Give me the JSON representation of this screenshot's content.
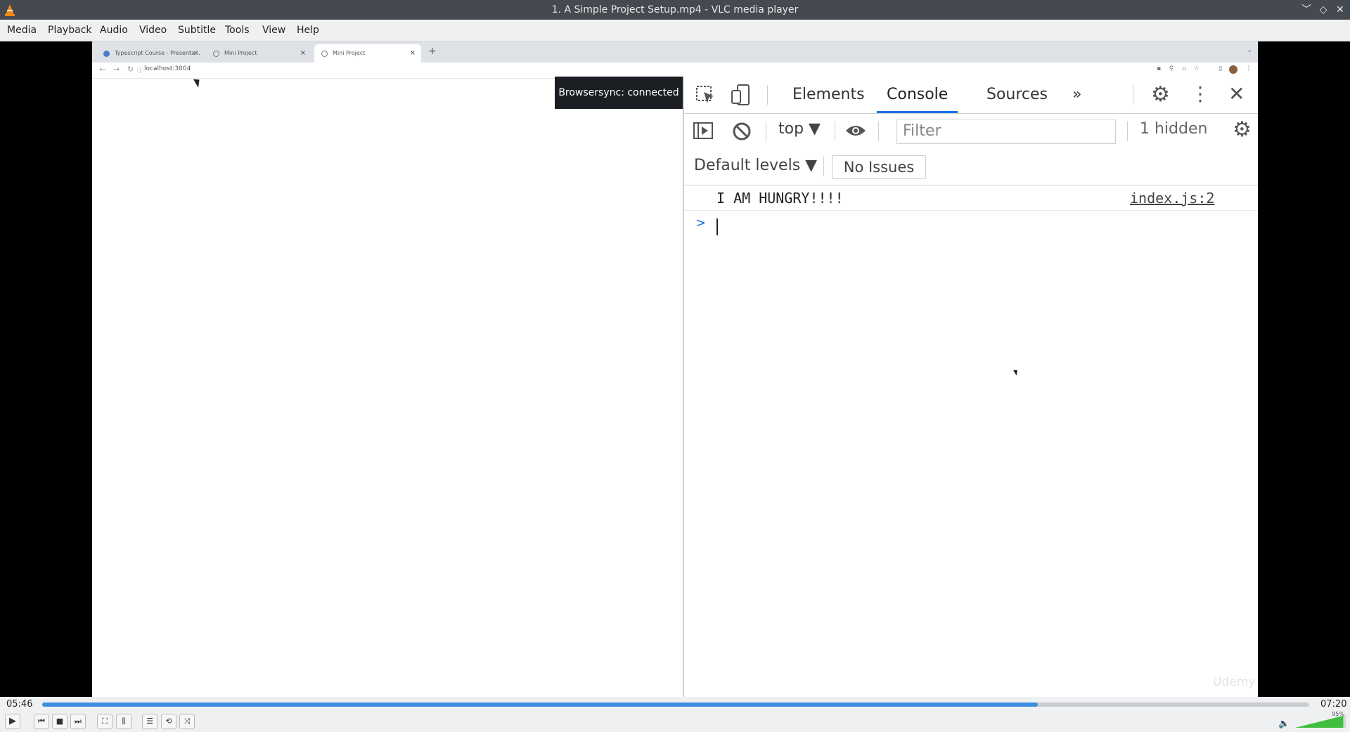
{
  "window": {
    "title": "1. A Simple Project Setup.mp4 - VLC media player"
  },
  "menu": [
    "Media",
    "Playback",
    "Audio",
    "Video",
    "Subtitle",
    "Tools",
    "View",
    "Help"
  ],
  "browser": {
    "tabs": [
      {
        "label": "Typescript Course - Presenta..."
      },
      {
        "label": "Mini Project"
      },
      {
        "label": "Mini Project"
      }
    ],
    "url": "localhost:3004"
  },
  "toast": "Browsersync: connected",
  "devtools": {
    "tabs": [
      "Elements",
      "Console",
      "Sources"
    ],
    "context": "top ▼",
    "filter_placeholder": "Filter",
    "hidden": "1 hidden",
    "levels": "Default levels ▼",
    "issues": "No Issues",
    "log": {
      "message": "I AM HUNGRY!!!!",
      "source": "index.js:2"
    }
  },
  "watermark": "Udemy",
  "player": {
    "elapsed": "05:46",
    "total": "07:20",
    "progress": 0.786,
    "volume_label": "95%",
    "volume": 0.95,
    "accent": "#3d8ee0"
  }
}
